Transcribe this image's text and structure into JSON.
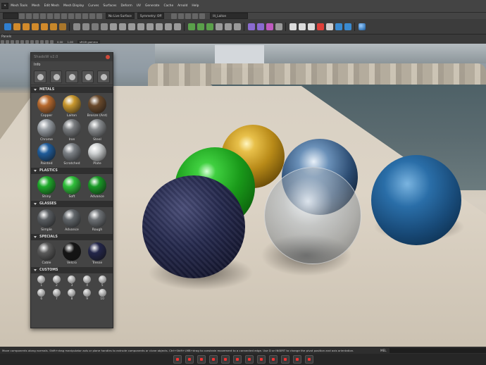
{
  "menubar": {
    "items": [
      "Mesh Tools",
      "Mesh",
      "Edit Mesh",
      "Mesh Display",
      "Curves",
      "Surfaces",
      "Deform",
      "UV",
      "Generate",
      "Cache",
      "Arnold",
      "Help"
    ],
    "live_surface": "No Live Surface",
    "symmetry": "Symmetry: Off",
    "object_field": "lit_Laiton"
  },
  "panels_label": "Panels",
  "viewport_fields": {
    "exposure": "0.00",
    "gamma": "1.00",
    "colorspace": "sRGB gamma"
  },
  "shadow_panel": {
    "title": "ShadoW v2.0",
    "info_label": "Info",
    "sections": {
      "metals": "METALS",
      "plastics": "PLASTICS",
      "glasses": "GLASSES",
      "specials": "SPECIALS",
      "customs": "CUSTOMS"
    },
    "metals": [
      {
        "label": "Copper",
        "color": "#b86a2e"
      },
      {
        "label": "Laiton",
        "color": "#c9982e"
      },
      {
        "label": "Bronze (Ant)",
        "color": "#6a4a2c"
      },
      {
        "label": "Chrome",
        "color": "#9aa0a6"
      },
      {
        "label": "Iron",
        "color": "#7a7d80"
      },
      {
        "label": "Steel",
        "color": "#8a8d90"
      },
      {
        "label": "Painted",
        "color": "#1f5c9a"
      },
      {
        "label": "Scratched",
        "color": "#7c8186"
      },
      {
        "label": "Plate",
        "color": "#cfd2d3"
      }
    ],
    "plastics": [
      {
        "label": "Shiny",
        "color": "#1eaa2a"
      },
      {
        "label": "Soft",
        "color": "#2fbf3a"
      },
      {
        "label": "Advance",
        "color": "#199a26"
      }
    ],
    "glasses": [
      {
        "label": "Simple",
        "color": "#5a5e62"
      },
      {
        "label": "Advance",
        "color": "#62676b"
      },
      {
        "label": "Rough",
        "color": "#6e7276"
      }
    ],
    "specials": [
      {
        "label": "Cable",
        "color": "#5a5a5a"
      },
      {
        "label": "Velcro",
        "color": "#151515"
      },
      {
        "label": "Tresse",
        "color": "#23264a"
      }
    ],
    "customs": [
      "1",
      "2",
      "3",
      "4",
      "5",
      "6",
      "7",
      "8",
      "9",
      "10"
    ]
  },
  "helpline": "Move components along normals. Shift+drag manipulator axis or plane handles to extrude components or clone objects. Ctrl+Shift+LMB+drag to constrain movement to a connected edge. Use D or INSERT to change the pivot position and axis orientation.",
  "mel_label": "MEL",
  "colors": {
    "accent": "#4a90d9",
    "close": "#d04a3a"
  }
}
